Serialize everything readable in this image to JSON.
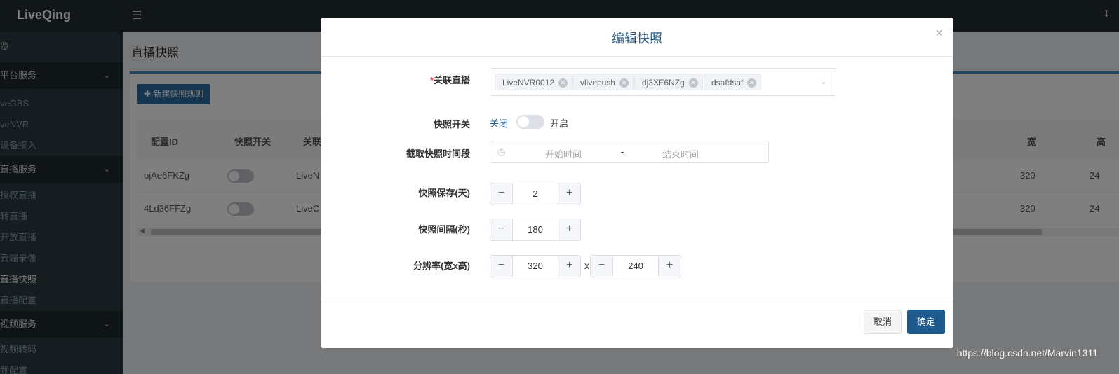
{
  "app": {
    "logo": "LiveQing"
  },
  "sidebar": {
    "items": [
      {
        "label": "览",
        "type": "item"
      },
      {
        "label": "平台服务",
        "type": "group"
      },
      {
        "label": "veGBS",
        "type": "sub"
      },
      {
        "label": "veNVR",
        "type": "sub"
      },
      {
        "label": "设备接入",
        "type": "sub"
      },
      {
        "label": "直播服务",
        "type": "group"
      },
      {
        "label": "授权直播",
        "type": "sub"
      },
      {
        "label": "转直播",
        "type": "sub"
      },
      {
        "label": "开放直播",
        "type": "sub"
      },
      {
        "label": "云端录像",
        "type": "sub"
      },
      {
        "label": "直播快照",
        "type": "sub-active"
      },
      {
        "label": "直播配置",
        "type": "sub"
      },
      {
        "label": "视频服务",
        "type": "group"
      },
      {
        "label": "视频转码",
        "type": "sub"
      },
      {
        "label": "频配置",
        "type": "sub"
      }
    ]
  },
  "page": {
    "title": "直播快照",
    "new_button": "✚ 新建快照规则",
    "table": {
      "headers": [
        "配置ID",
        "快照开关",
        "关联",
        "宽",
        "高"
      ],
      "rows": [
        {
          "id": "ojAe6FKZg",
          "live": "LiveN",
          "width": "320",
          "height": "24"
        },
        {
          "id": "4Ld36FFZg",
          "live": "LiveC",
          "width": "320",
          "height": "24"
        }
      ]
    }
  },
  "dialog": {
    "title": "编辑快照",
    "close": "×",
    "fields": {
      "live": {
        "label": "关联直播",
        "required_mark": "*",
        "tags": [
          "LiveNVR0012",
          "vlivepush",
          "dj3XF6NZg",
          "dsafdsaf"
        ]
      },
      "switch": {
        "label": "快照开关",
        "off": "关闭",
        "on": "开启",
        "enabled": false
      },
      "time_range": {
        "label": "截取快照时间段",
        "start_placeholder": "开始时间",
        "separator": "-",
        "end_placeholder": "结束时间"
      },
      "keep_days": {
        "label": "快照保存(天)",
        "value": "2"
      },
      "interval": {
        "label": "快照间隔(秒)",
        "value": "180"
      },
      "resolution": {
        "label": "分辨率(宽x高)",
        "width": "320",
        "x": "x",
        "height": "240"
      }
    },
    "cancel": "取消",
    "ok": "确定"
  },
  "watermark": "https://blog.csdn.net/Marvin1311"
}
